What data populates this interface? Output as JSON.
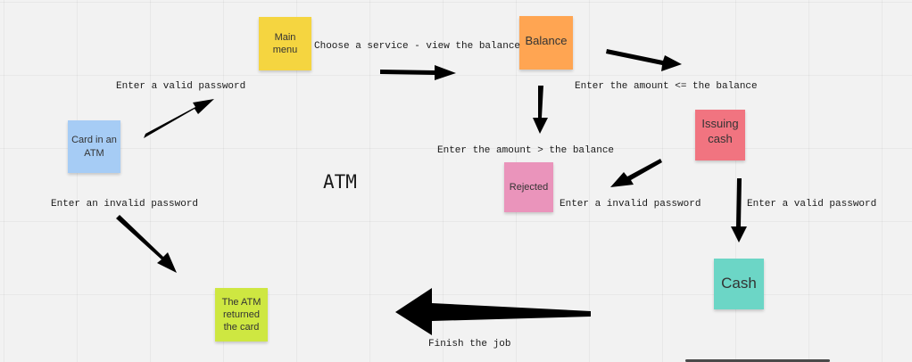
{
  "title": "ATM",
  "colors": {
    "yellow": "#f5d540",
    "orange": "#ffa552",
    "blue": "#a6ccf5",
    "red": "#f17480",
    "pink": "#ea94bb",
    "teal": "#6cd6c6",
    "lime": "#cee741",
    "arrow": "#000000"
  },
  "notes": {
    "card": "Card in an ATM",
    "main_menu": "Main menu",
    "balance": "Balance",
    "issuing_cash": "Issuing cash",
    "rejected": "Rejected",
    "cash": "Cash",
    "returned": "The ATM returned the card"
  },
  "labels": {
    "valid_password": "Enter a valid password",
    "invalid_password": "Enter an invalid password",
    "choose_service": "Choose a service - view the balance",
    "amount_le_balance": "Enter the amount <= the balance",
    "amount_gt_balance": "Enter the amount > the balance",
    "rejected_invalid_password": "Enter a invalid password",
    "cash_valid_password": "Enter a valid password",
    "finish": "Finish the job"
  }
}
